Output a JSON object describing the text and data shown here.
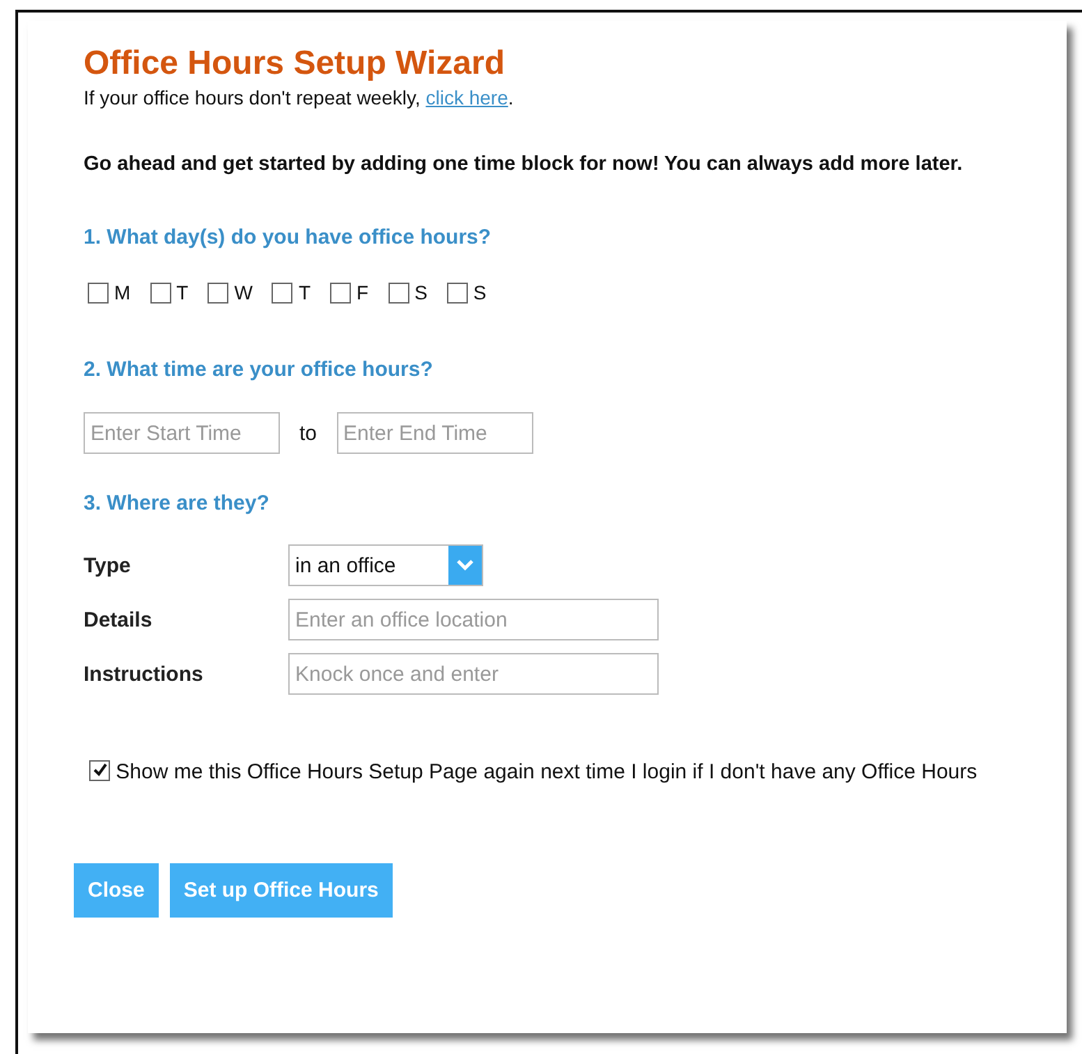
{
  "title": "Office Hours Setup Wizard",
  "subtitle": {
    "text": "If your office hours don't repeat weekly, ",
    "link": "click here",
    "end": "."
  },
  "intro": "Go ahead and get started by adding one time block for now! You can always add more later.",
  "q1": "1. What day(s) do you have office hours?",
  "days": [
    {
      "label": "M",
      "checked": false
    },
    {
      "label": "T",
      "checked": false
    },
    {
      "label": "W",
      "checked": false
    },
    {
      "label": "T",
      "checked": false
    },
    {
      "label": "F",
      "checked": false
    },
    {
      "label": "S",
      "checked": false
    },
    {
      "label": "S",
      "checked": false
    }
  ],
  "q2": "2. What time are your office hours?",
  "start_time": {
    "placeholder": "Enter Start Time"
  },
  "to": "to",
  "end_time": {
    "placeholder": "Enter End Time"
  },
  "q3": "3. Where are they?",
  "type": {
    "label": "Type",
    "value": "in an office"
  },
  "details": {
    "label": "Details",
    "placeholder": "Enter an office location"
  },
  "instructions": {
    "label": "Instructions",
    "placeholder": "Knock once and enter"
  },
  "show_again": {
    "label": "Show me this Office Hours Setup Page again next time I login if I don't have any Office Hours",
    "checked": true
  },
  "buttons": [
    "Close",
    "Set up Office Hours"
  ]
}
